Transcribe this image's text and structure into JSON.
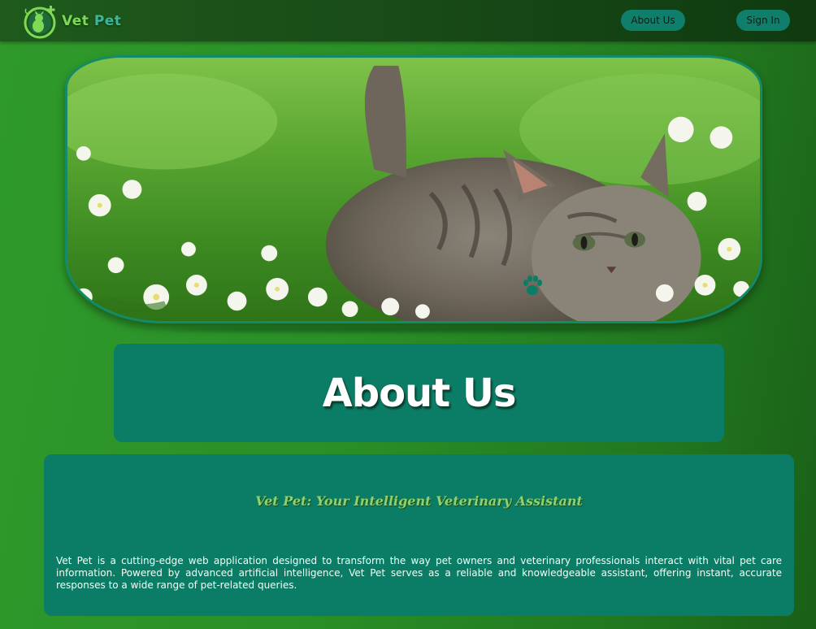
{
  "navbar": {
    "logo_word1": "Vet",
    "logo_word2": "Pet",
    "about_label": "About Us",
    "signin_label": "Sign In"
  },
  "hero": {
    "image": "kitten-in-grass-with-white-flowers",
    "paw_icon": "paw-icon"
  },
  "about": {
    "title": "About Us"
  },
  "info": {
    "heading": "Vet Pet: Your Intelligent Veterinary Assistant",
    "body": "Vet Pet is a cutting-edge web application designed to transform the way pet owners and veterinary professionals interact with vital pet care information. Powered by advanced artificial intelligence, Vet Pet serves as a reliable and knowledgeable assistant, offering instant, accurate responses to a wide range of pet-related queries."
  },
  "colors": {
    "accent": "#0b7d66",
    "nav_bg": "#1a4e18",
    "page_green": "#2a8f27",
    "logo_green": "#7ed957"
  }
}
